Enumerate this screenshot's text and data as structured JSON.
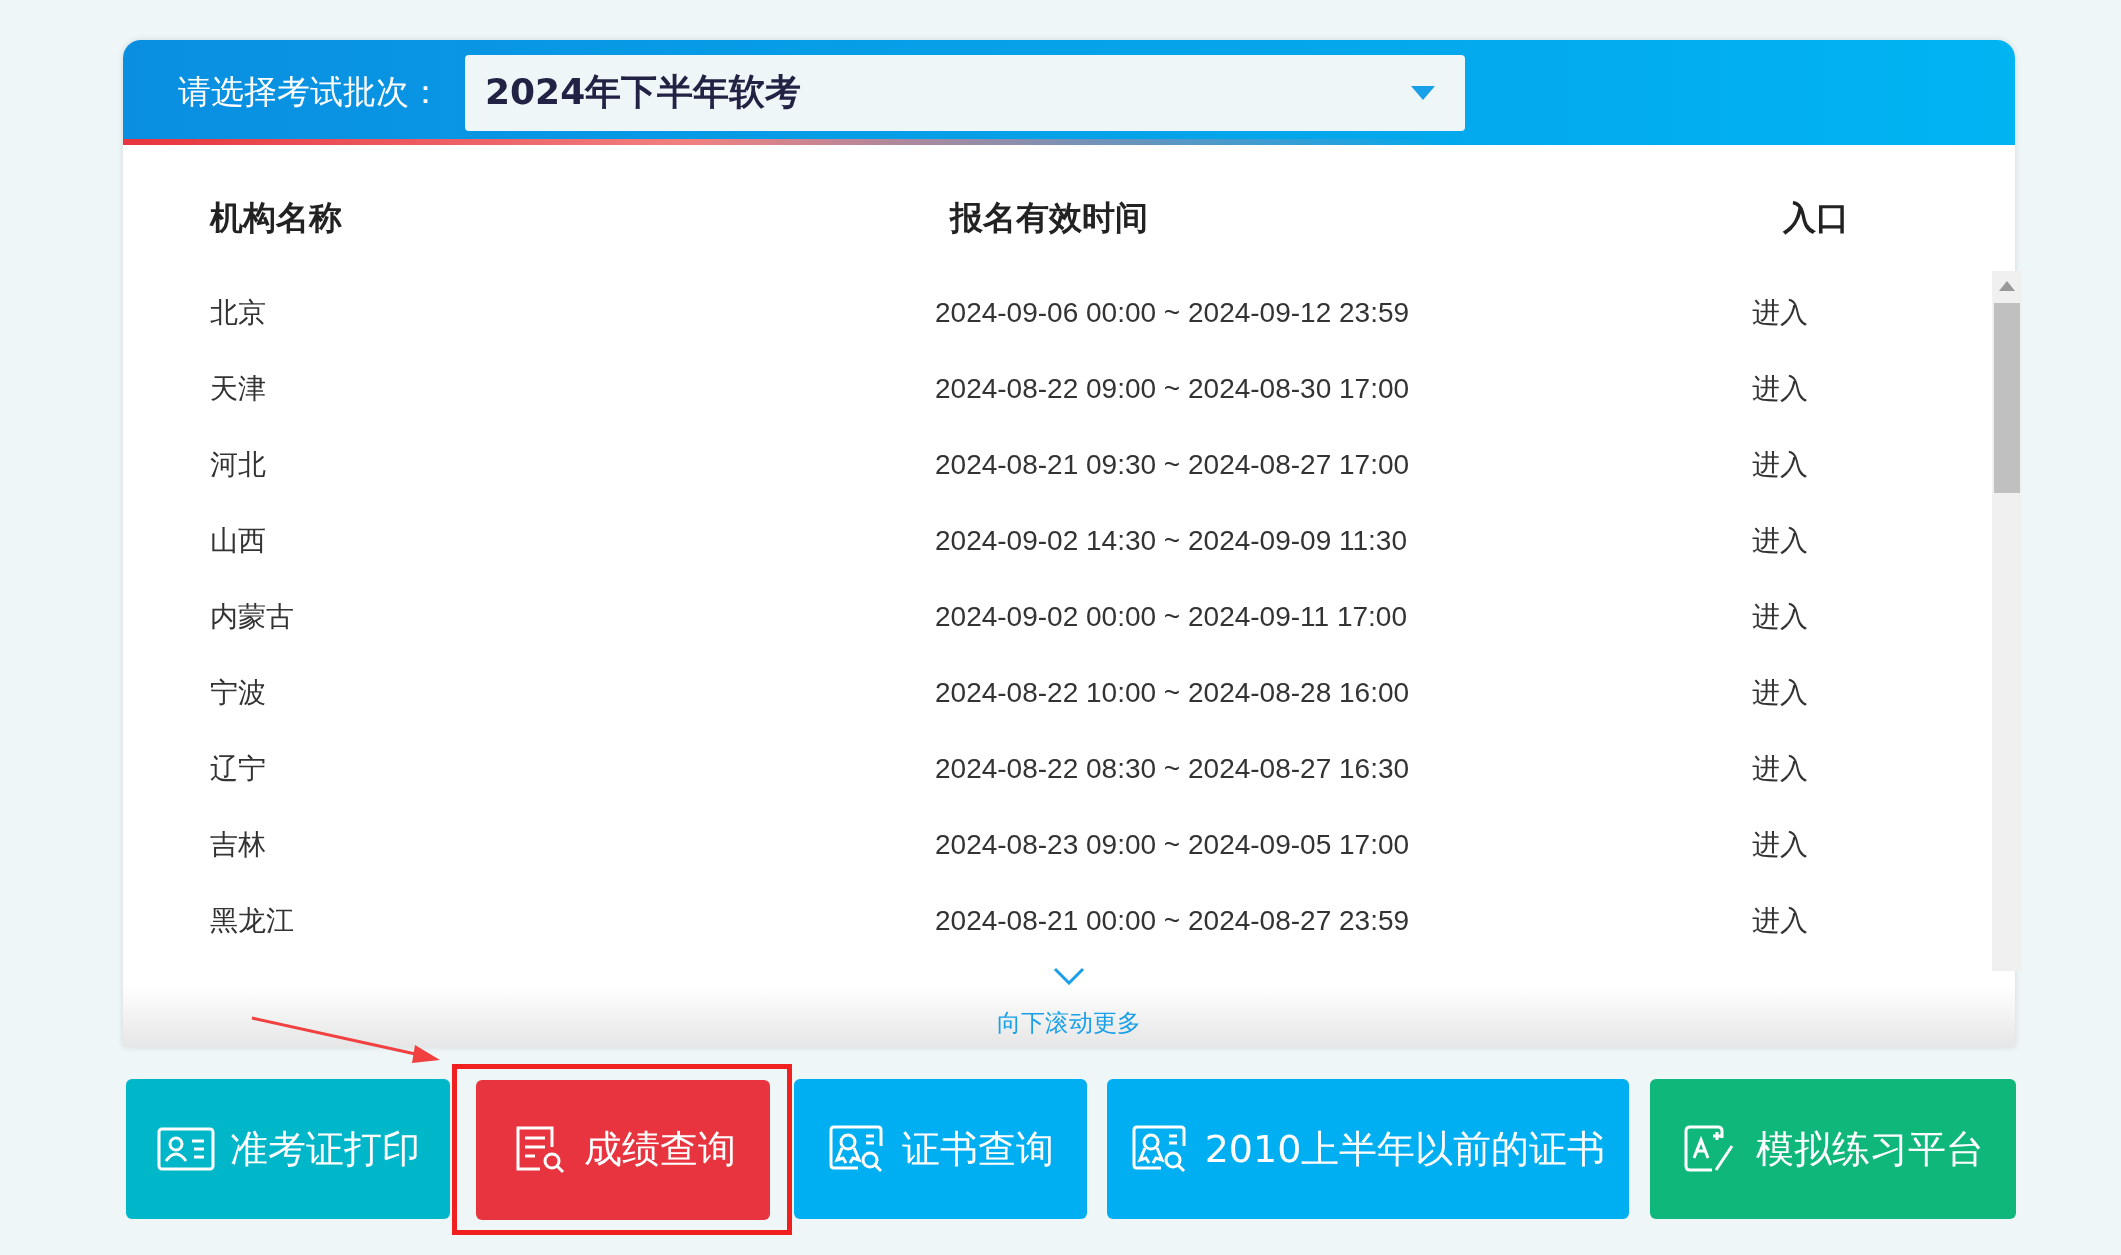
{
  "header": {
    "label": "请选择考试批次：",
    "select": {
      "value": "2024年下半年软考"
    }
  },
  "table": {
    "columns": [
      "机构名称",
      "报名有效时间",
      "入口"
    ],
    "rows": [
      {
        "name": "北京",
        "time": "2024-09-06 00:00 ~ 2024-09-12 23:59",
        "entry": "进入"
      },
      {
        "name": "天津",
        "time": "2024-08-22 09:00 ~ 2024-08-30 17:00",
        "entry": "进入"
      },
      {
        "name": "河北",
        "time": "2024-08-21 09:30 ~ 2024-08-27 17:00",
        "entry": "进入"
      },
      {
        "name": "山西",
        "time": "2024-09-02 14:30 ~ 2024-09-09 11:30",
        "entry": "进入"
      },
      {
        "name": "内蒙古",
        "time": "2024-09-02 00:00 ~ 2024-09-11 17:00",
        "entry": "进入"
      },
      {
        "name": "宁波",
        "time": "2024-08-22 10:00 ~ 2024-08-28 16:00",
        "entry": "进入"
      },
      {
        "name": "辽宁",
        "time": "2024-08-22 08:30 ~ 2024-08-27 16:30",
        "entry": "进入"
      },
      {
        "name": "吉林",
        "time": "2024-08-23 09:00 ~ 2024-09-05 17:00",
        "entry": "进入"
      },
      {
        "name": "黑龙江",
        "time": "2024-08-21 00:00 ~ 2024-08-27 23:59",
        "entry": "进入"
      }
    ]
  },
  "scroll_hint": {
    "text": "向下滚动更多"
  },
  "buttons": [
    {
      "label": "准考证打印",
      "kind": "id-card",
      "color": "#00b6c9",
      "highlighted": false
    },
    {
      "label": "成绩查询",
      "kind": "document-search",
      "color": "#e8343e",
      "highlighted": true
    },
    {
      "label": "证书查询",
      "kind": "certificate-search",
      "color": "#00aef2",
      "highlighted": false
    },
    {
      "label": "2010上半年以前的证书",
      "kind": "certificate-search",
      "color": "#00aef2",
      "highlighted": false
    },
    {
      "label": "模拟练习平台",
      "kind": "practice",
      "color": "#10b77a",
      "highlighted": false
    }
  ]
}
